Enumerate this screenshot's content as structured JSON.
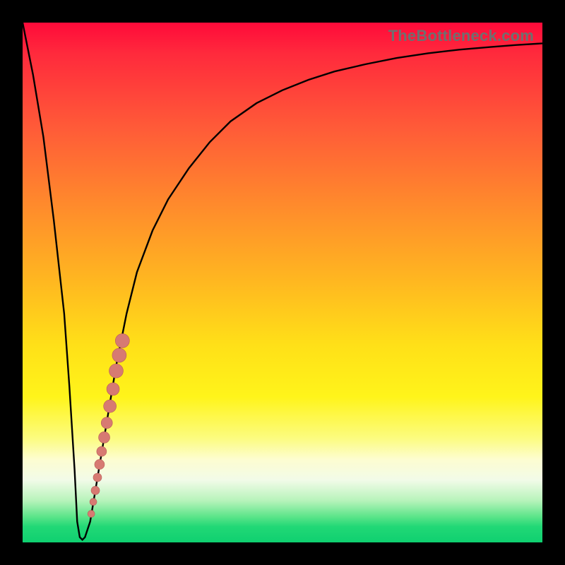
{
  "watermark": "TheBottleneck.com",
  "colors": {
    "curve_stroke": "#000000",
    "dot_fill": "#d77a72",
    "dot_stroke": "#b85e57"
  },
  "chart_data": {
    "type": "line",
    "title": "",
    "xlabel": "",
    "ylabel": "",
    "xlim": [
      0,
      100
    ],
    "ylim": [
      0,
      100
    ],
    "series": [
      {
        "name": "bottleneck-curve",
        "x": [
          0,
          2,
          4,
          6,
          8,
          9,
          10,
          10.5,
          11,
          11.5,
          12,
          13,
          14,
          16,
          18,
          20,
          22,
          25,
          28,
          32,
          36,
          40,
          45,
          50,
          55,
          60,
          66,
          72,
          78,
          84,
          90,
          95,
          100
        ],
        "y": [
          100,
          90,
          78,
          62,
          44,
          30,
          14,
          4,
          1,
          0.5,
          1,
          4,
          10,
          22,
          34,
          44,
          52,
          60,
          66,
          72,
          77,
          81,
          84.5,
          87,
          89,
          90.6,
          92,
          93.2,
          94.1,
          94.8,
          95.3,
          95.7,
          96
        ]
      }
    ],
    "scatter": {
      "name": "highlight-dots",
      "points": [
        {
          "x": 13.2,
          "y": 5.5,
          "r": 5
        },
        {
          "x": 13.6,
          "y": 7.8,
          "r": 5
        },
        {
          "x": 14.0,
          "y": 10.0,
          "r": 6
        },
        {
          "x": 14.4,
          "y": 12.5,
          "r": 6
        },
        {
          "x": 14.8,
          "y": 15.0,
          "r": 7
        },
        {
          "x": 15.2,
          "y": 17.5,
          "r": 7
        },
        {
          "x": 15.7,
          "y": 20.2,
          "r": 8
        },
        {
          "x": 16.2,
          "y": 23.0,
          "r": 8
        },
        {
          "x": 16.8,
          "y": 26.2,
          "r": 9
        },
        {
          "x": 17.4,
          "y": 29.5,
          "r": 9
        },
        {
          "x": 18.0,
          "y": 33.0,
          "r": 10
        },
        {
          "x": 18.6,
          "y": 36.0,
          "r": 10
        },
        {
          "x": 19.2,
          "y": 38.8,
          "r": 10
        }
      ]
    }
  }
}
